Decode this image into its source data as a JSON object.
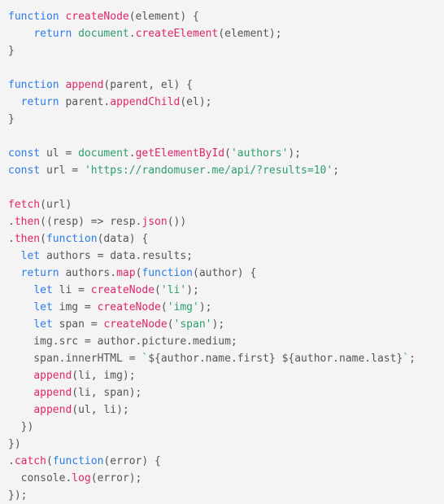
{
  "editor": {
    "language": "javascript",
    "background_color": "#f4f4f4",
    "font_size_px": 13,
    "line_height_px": 21,
    "colors": {
      "keyword": "#2b7ce9",
      "function": "#e0256b",
      "string": "#2c9e6b",
      "builtin": "#2c9e6b",
      "plain": "#555555",
      "background": "#f4f4f4"
    },
    "line_count": 27
  },
  "code": {
    "lines": [
      {
        "n": 1,
        "text": "function createNode(element) {",
        "tokens": [
          {
            "t": "function",
            "c": "kw"
          },
          {
            "t": " ",
            "c": "pl"
          },
          {
            "t": "createNode",
            "c": "fn"
          },
          {
            "t": "(element) {",
            "c": "pl"
          }
        ]
      },
      {
        "n": 2,
        "text": "    return document.createElement(element);",
        "tokens": [
          {
            "t": "    ",
            "c": "pl"
          },
          {
            "t": "return",
            "c": "kw"
          },
          {
            "t": " ",
            "c": "pl"
          },
          {
            "t": "document",
            "c": "bi"
          },
          {
            "t": ".",
            "c": "pl"
          },
          {
            "t": "createElement",
            "c": "fn"
          },
          {
            "t": "(element);",
            "c": "pl"
          }
        ]
      },
      {
        "n": 3,
        "text": "}",
        "tokens": [
          {
            "t": "}",
            "c": "pl"
          }
        ]
      },
      {
        "n": 4,
        "text": "",
        "tokens": []
      },
      {
        "n": 5,
        "text": "function append(parent, el) {",
        "tokens": [
          {
            "t": "function",
            "c": "kw"
          },
          {
            "t": " ",
            "c": "pl"
          },
          {
            "t": "append",
            "c": "fn"
          },
          {
            "t": "(parent, el) {",
            "c": "pl"
          }
        ]
      },
      {
        "n": 6,
        "text": "  return parent.appendChild(el);",
        "tokens": [
          {
            "t": "  ",
            "c": "pl"
          },
          {
            "t": "return",
            "c": "kw"
          },
          {
            "t": " parent.",
            "c": "pl"
          },
          {
            "t": "appendChild",
            "c": "fn"
          },
          {
            "t": "(el);",
            "c": "pl"
          }
        ]
      },
      {
        "n": 7,
        "text": "}",
        "tokens": [
          {
            "t": "}",
            "c": "pl"
          }
        ]
      },
      {
        "n": 8,
        "text": "",
        "tokens": []
      },
      {
        "n": 9,
        "text": "const ul = document.getElementById('authors');",
        "tokens": [
          {
            "t": "const",
            "c": "kw"
          },
          {
            "t": " ul = ",
            "c": "pl"
          },
          {
            "t": "document",
            "c": "bi"
          },
          {
            "t": ".",
            "c": "pl"
          },
          {
            "t": "getElementById",
            "c": "fn"
          },
          {
            "t": "(",
            "c": "pl"
          },
          {
            "t": "'authors'",
            "c": "str"
          },
          {
            "t": ");",
            "c": "pl"
          }
        ]
      },
      {
        "n": 10,
        "text": "const url = 'https://randomuser.me/api/?results=10';",
        "tokens": [
          {
            "t": "const",
            "c": "kw"
          },
          {
            "t": " url = ",
            "c": "pl"
          },
          {
            "t": "'https://randomuser.me/api/?results=10'",
            "c": "str"
          },
          {
            "t": ";",
            "c": "pl"
          }
        ]
      },
      {
        "n": 11,
        "text": "",
        "tokens": []
      },
      {
        "n": 12,
        "text": "fetch(url)",
        "tokens": [
          {
            "t": "fetch",
            "c": "fn"
          },
          {
            "t": "(url)",
            "c": "pl"
          }
        ]
      },
      {
        "n": 13,
        "text": ".then((resp) => resp.json())",
        "tokens": [
          {
            "t": ".",
            "c": "pl"
          },
          {
            "t": "then",
            "c": "fn"
          },
          {
            "t": "((resp) => resp.",
            "c": "pl"
          },
          {
            "t": "json",
            "c": "fn"
          },
          {
            "t": "())",
            "c": "pl"
          }
        ]
      },
      {
        "n": 14,
        "text": ".then(function(data) {",
        "tokens": [
          {
            "t": ".",
            "c": "pl"
          },
          {
            "t": "then",
            "c": "fn"
          },
          {
            "t": "(",
            "c": "pl"
          },
          {
            "t": "function",
            "c": "kw"
          },
          {
            "t": "(data) {",
            "c": "pl"
          }
        ]
      },
      {
        "n": 15,
        "text": "  let authors = data.results;",
        "tokens": [
          {
            "t": "  ",
            "c": "pl"
          },
          {
            "t": "let",
            "c": "kw"
          },
          {
            "t": " authors = data.results;",
            "c": "pl"
          }
        ]
      },
      {
        "n": 16,
        "text": "  return authors.map(function(author) {",
        "tokens": [
          {
            "t": "  ",
            "c": "pl"
          },
          {
            "t": "return",
            "c": "kw"
          },
          {
            "t": " authors.",
            "c": "pl"
          },
          {
            "t": "map",
            "c": "fn"
          },
          {
            "t": "(",
            "c": "pl"
          },
          {
            "t": "function",
            "c": "kw"
          },
          {
            "t": "(author) {",
            "c": "pl"
          }
        ]
      },
      {
        "n": 17,
        "text": "    let li = createNode('li');",
        "tokens": [
          {
            "t": "    ",
            "c": "pl"
          },
          {
            "t": "let",
            "c": "kw"
          },
          {
            "t": " li = ",
            "c": "pl"
          },
          {
            "t": "createNode",
            "c": "fn"
          },
          {
            "t": "(",
            "c": "pl"
          },
          {
            "t": "'li'",
            "c": "str"
          },
          {
            "t": ");",
            "c": "pl"
          }
        ]
      },
      {
        "n": 18,
        "text": "    let img = createNode('img');",
        "tokens": [
          {
            "t": "    ",
            "c": "pl"
          },
          {
            "t": "let",
            "c": "kw"
          },
          {
            "t": " img = ",
            "c": "pl"
          },
          {
            "t": "createNode",
            "c": "fn"
          },
          {
            "t": "(",
            "c": "pl"
          },
          {
            "t": "'img'",
            "c": "str"
          },
          {
            "t": ");",
            "c": "pl"
          }
        ]
      },
      {
        "n": 19,
        "text": "    let span = createNode('span');",
        "tokens": [
          {
            "t": "    ",
            "c": "pl"
          },
          {
            "t": "let",
            "c": "kw"
          },
          {
            "t": " span = ",
            "c": "pl"
          },
          {
            "t": "createNode",
            "c": "fn"
          },
          {
            "t": "(",
            "c": "pl"
          },
          {
            "t": "'span'",
            "c": "str"
          },
          {
            "t": ");",
            "c": "pl"
          }
        ]
      },
      {
        "n": 20,
        "text": "    img.src = author.picture.medium;",
        "tokens": [
          {
            "t": "    img.src = author.picture.medium;",
            "c": "pl"
          }
        ]
      },
      {
        "n": 21,
        "text": "    span.innerHTML = `${author.name.first} ${author.name.last}`;",
        "tokens": [
          {
            "t": "    span.innerHTML = ",
            "c": "pl"
          },
          {
            "t": "`",
            "c": "str"
          },
          {
            "t": "${author.name.first} ${author.name.last}",
            "c": "pl"
          },
          {
            "t": "`",
            "c": "str"
          },
          {
            "t": ";",
            "c": "pl"
          }
        ]
      },
      {
        "n": 22,
        "text": "    append(li, img);",
        "tokens": [
          {
            "t": "    ",
            "c": "pl"
          },
          {
            "t": "append",
            "c": "fn"
          },
          {
            "t": "(li, img);",
            "c": "pl"
          }
        ]
      },
      {
        "n": 23,
        "text": "    append(li, span);",
        "tokens": [
          {
            "t": "    ",
            "c": "pl"
          },
          {
            "t": "append",
            "c": "fn"
          },
          {
            "t": "(li, span);",
            "c": "pl"
          }
        ]
      },
      {
        "n": 24,
        "text": "    append(ul, li);",
        "tokens": [
          {
            "t": "    ",
            "c": "pl"
          },
          {
            "t": "append",
            "c": "fn"
          },
          {
            "t": "(ul, li);",
            "c": "pl"
          }
        ]
      },
      {
        "n": 25,
        "text": "  })",
        "tokens": [
          {
            "t": "  })",
            "c": "pl"
          }
        ]
      },
      {
        "n": 26,
        "text": "})",
        "tokens": [
          {
            "t": "})",
            "c": "pl"
          }
        ]
      },
      {
        "n": 27,
        "text": ".catch(function(error) {",
        "tokens": [
          {
            "t": ".",
            "c": "pl"
          },
          {
            "t": "catch",
            "c": "fn"
          },
          {
            "t": "(",
            "c": "pl"
          },
          {
            "t": "function",
            "c": "kw"
          },
          {
            "t": "(error) {",
            "c": "pl"
          }
        ]
      },
      {
        "n": 28,
        "text": "  console.log(error);",
        "tokens": [
          {
            "t": "  console.",
            "c": "pl"
          },
          {
            "t": "log",
            "c": "fn"
          },
          {
            "t": "(error);",
            "c": "pl"
          }
        ]
      },
      {
        "n": 29,
        "text": "});",
        "tokens": [
          {
            "t": "});",
            "c": "pl"
          }
        ]
      }
    ]
  }
}
